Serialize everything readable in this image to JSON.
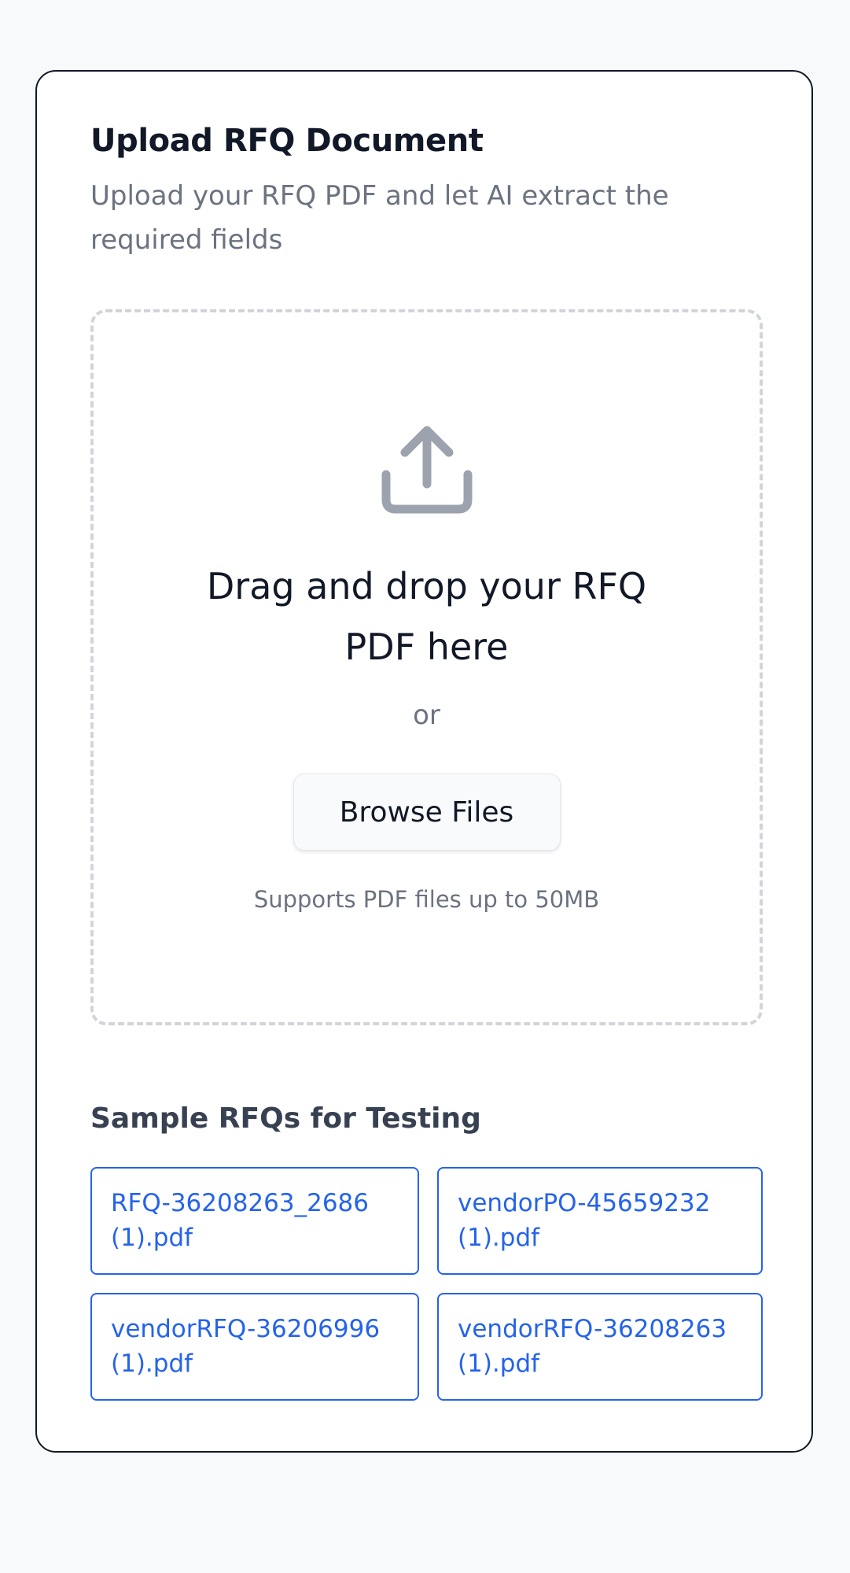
{
  "card": {
    "title": "Upload RFQ Document",
    "subtitle": "Upload your RFQ PDF and let AI extract the required fields"
  },
  "dropzone": {
    "icon": "upload-icon",
    "title": "Drag and drop your RFQ PDF here",
    "or_text": "or",
    "browse_label": "Browse Files",
    "supports_text": "Supports PDF files up to 50MB"
  },
  "samples": {
    "heading": "Sample RFQs for Testing",
    "items": [
      {
        "label": "RFQ-36208263_2686 (1).pdf"
      },
      {
        "label": "vendorPO-45659232 (1).pdf"
      },
      {
        "label": "vendorRFQ-36206996 (1).pdf"
      },
      {
        "label": "vendorRFQ-36208263 (1).pdf"
      }
    ]
  },
  "colors": {
    "background": "#f8f9fb",
    "text_primary": "#111827",
    "text_muted": "#6b7280",
    "dashed_border": "#d1d5db",
    "icon_gray": "#9ca3af",
    "link_blue": "#2563eb"
  }
}
